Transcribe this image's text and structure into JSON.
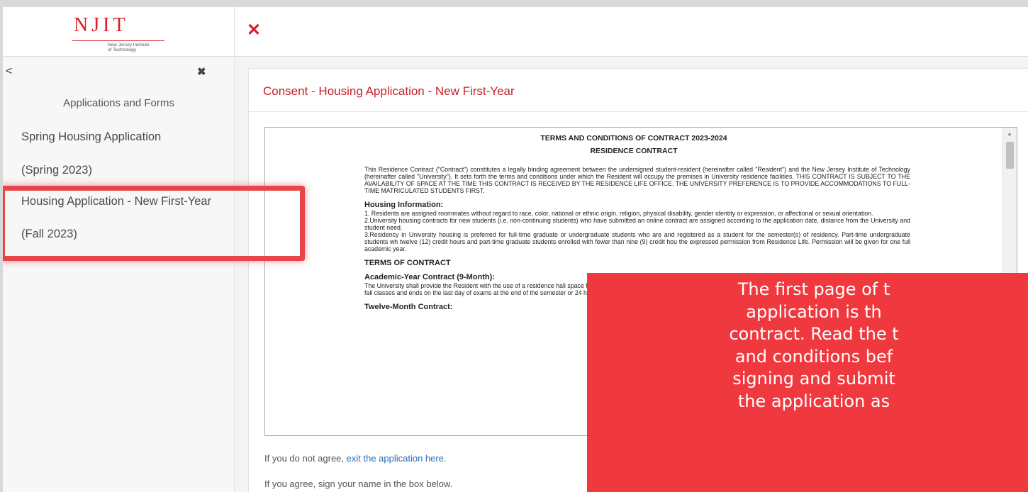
{
  "logo": {
    "text": "NJIT",
    "subtitle_line1": "New Jersey Institute",
    "subtitle_line2": "of Technology"
  },
  "sidebar": {
    "back_glyph": "<",
    "close_glyph": "✖",
    "heading": "Applications and Forms",
    "items": [
      {
        "label": "Spring Housing Application"
      },
      {
        "label": "(Spring 2023)"
      },
      {
        "label": "Housing Application - New First-Year"
      },
      {
        "label": "(Fall 2023)"
      }
    ]
  },
  "topbar": {
    "close_glyph": "✕"
  },
  "panel": {
    "title": "Consent - Housing Application - New First-Year",
    "doc": {
      "heading": "TERMS AND CONDITIONS OF CONTRACT 2023-2024",
      "subheading": "RESIDENCE CONTRACT",
      "intro": "This Residence Contract (\"Contract\") constitutes a legally binding agreement between the undersigned student-resident (hereinafter called \"Resident\") and the New Jersey Institute of Technology (hereinafter called \"University\"). It sets forth the terms and conditions under which the Resident will occupy the premises in University residence facilities. THIS CONTRACT IS SUBJECT TO THE AVAILABILITY OF SPACE AT THE TIME THIS CONTRACT IS RECEIVED BY THE RESIDENCE LIFE OFFICE. THE UNIVERSITY PREFERENCE IS TO PROVIDE ACCOMMODATIONS TO FULL-TIME MATRICULATED STUDENTS FIRST.",
      "section_housing": "Housing Information:",
      "housing_items": [
        "1. Residents are assigned roommates without regard to race, color, national or ethnic origin, religion, physical disability, gender identity or expression, or affectional or sexual orientation.",
        "2.University housing contracts for new students (i.e. non-continuing students) who have submitted an online contract are assigned according to the application date, distance from the University and student need.",
        "3.Residency in University housing is preferred for full-time graduate or undergraduate students who are and registered as a student for the semester(s) of residency. Part-time undergraduate students wh twelve (12) credit hours and part-time graduate students enrolled with fewer than nine (9) credit hou the expressed permission from Residence Life. Permission will be given for one full academic year."
      ],
      "section_terms": "TERMS OF CONTRACT",
      "academic_heading": "Academic-Year Contract (9-Month):",
      "academic_text": "The University shall provide the Resident with the use of a residence hall space for one academic-y time of assignment. This period does NOT include summer break. The contract period commence fall classes and ends on the last day of exams at the end of the semester or 24 hours after a Resi earlier.",
      "twelve_heading": "Twelve-Month Contract:"
    },
    "disagree_prefix": "If you do not agree, ",
    "disagree_link": "exit the application here.",
    "agree_text": "If you agree, sign your name in the box below."
  },
  "callout": {
    "lines": [
      "The first page of t",
      "application is th",
      "contract. Read the t",
      "and conditions bef",
      "signing and submit",
      "the application as"
    ]
  },
  "colors": {
    "accent": "#d61f26",
    "callout_bg": "#f0393f",
    "highlight": "#e8454b"
  }
}
